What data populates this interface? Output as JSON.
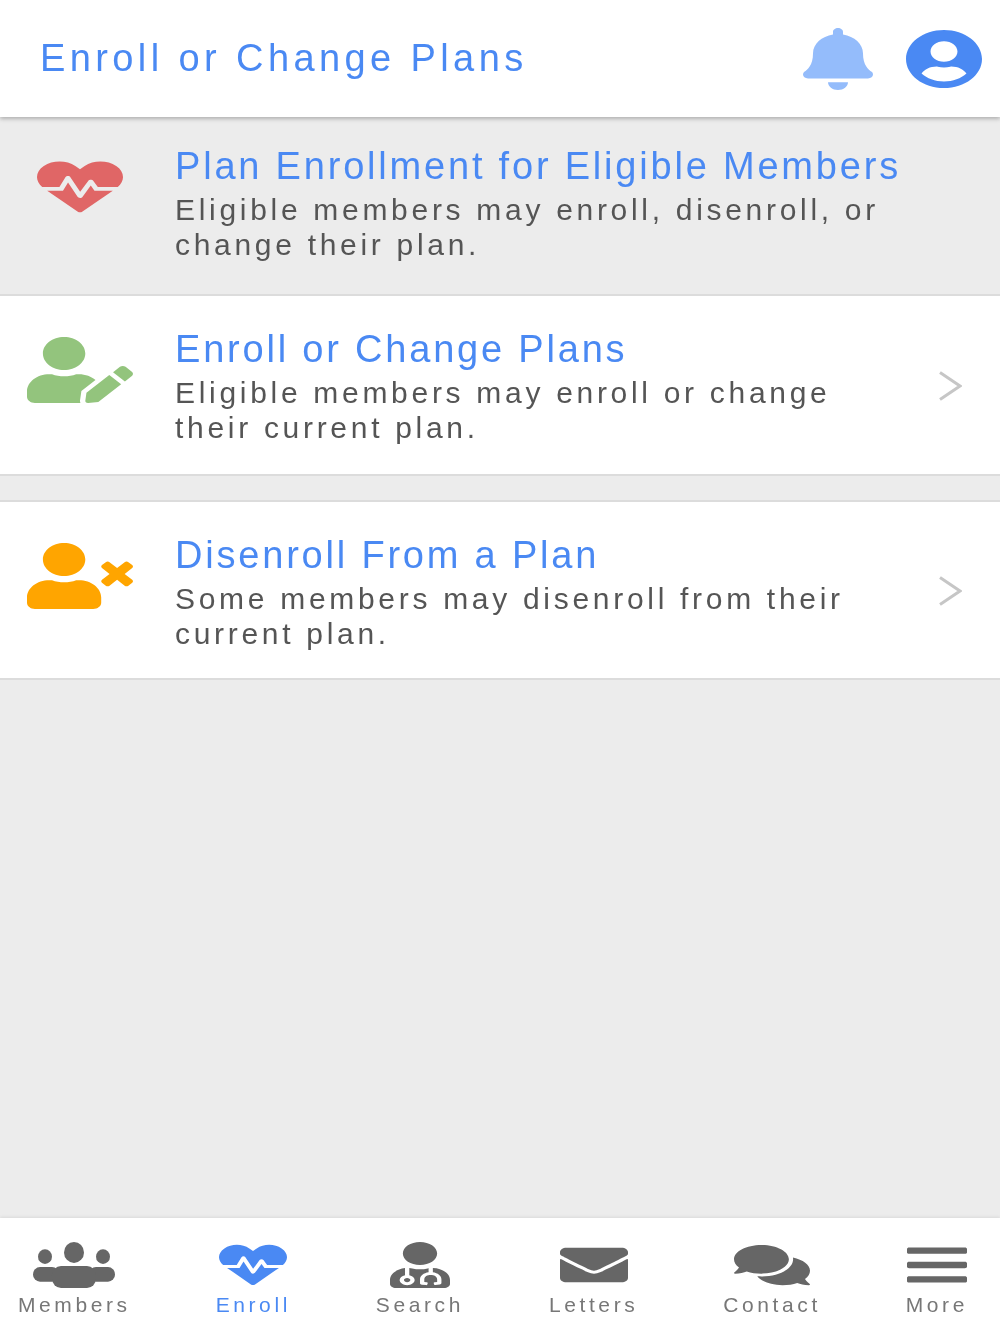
{
  "header": {
    "title": "Enroll or Change Plans"
  },
  "intro": {
    "title": "Plan Enrollment for Eligible Members",
    "description": "Eligible members may enroll, disenroll, or change their plan."
  },
  "options": [
    {
      "title": "Enroll or Change Plans",
      "description": "Eligible members may enroll or change their current plan."
    },
    {
      "title": "Disenroll From a Plan",
      "description": "Some members may disenroll from their current plan."
    }
  ],
  "tabs": [
    {
      "label": "Members",
      "selected": false
    },
    {
      "label": "Enroll",
      "selected": true
    },
    {
      "label": "Search",
      "selected": false
    },
    {
      "label": "Letters",
      "selected": false
    },
    {
      "label": "Contact",
      "selected": false
    },
    {
      "label": "More",
      "selected": false
    }
  ]
}
